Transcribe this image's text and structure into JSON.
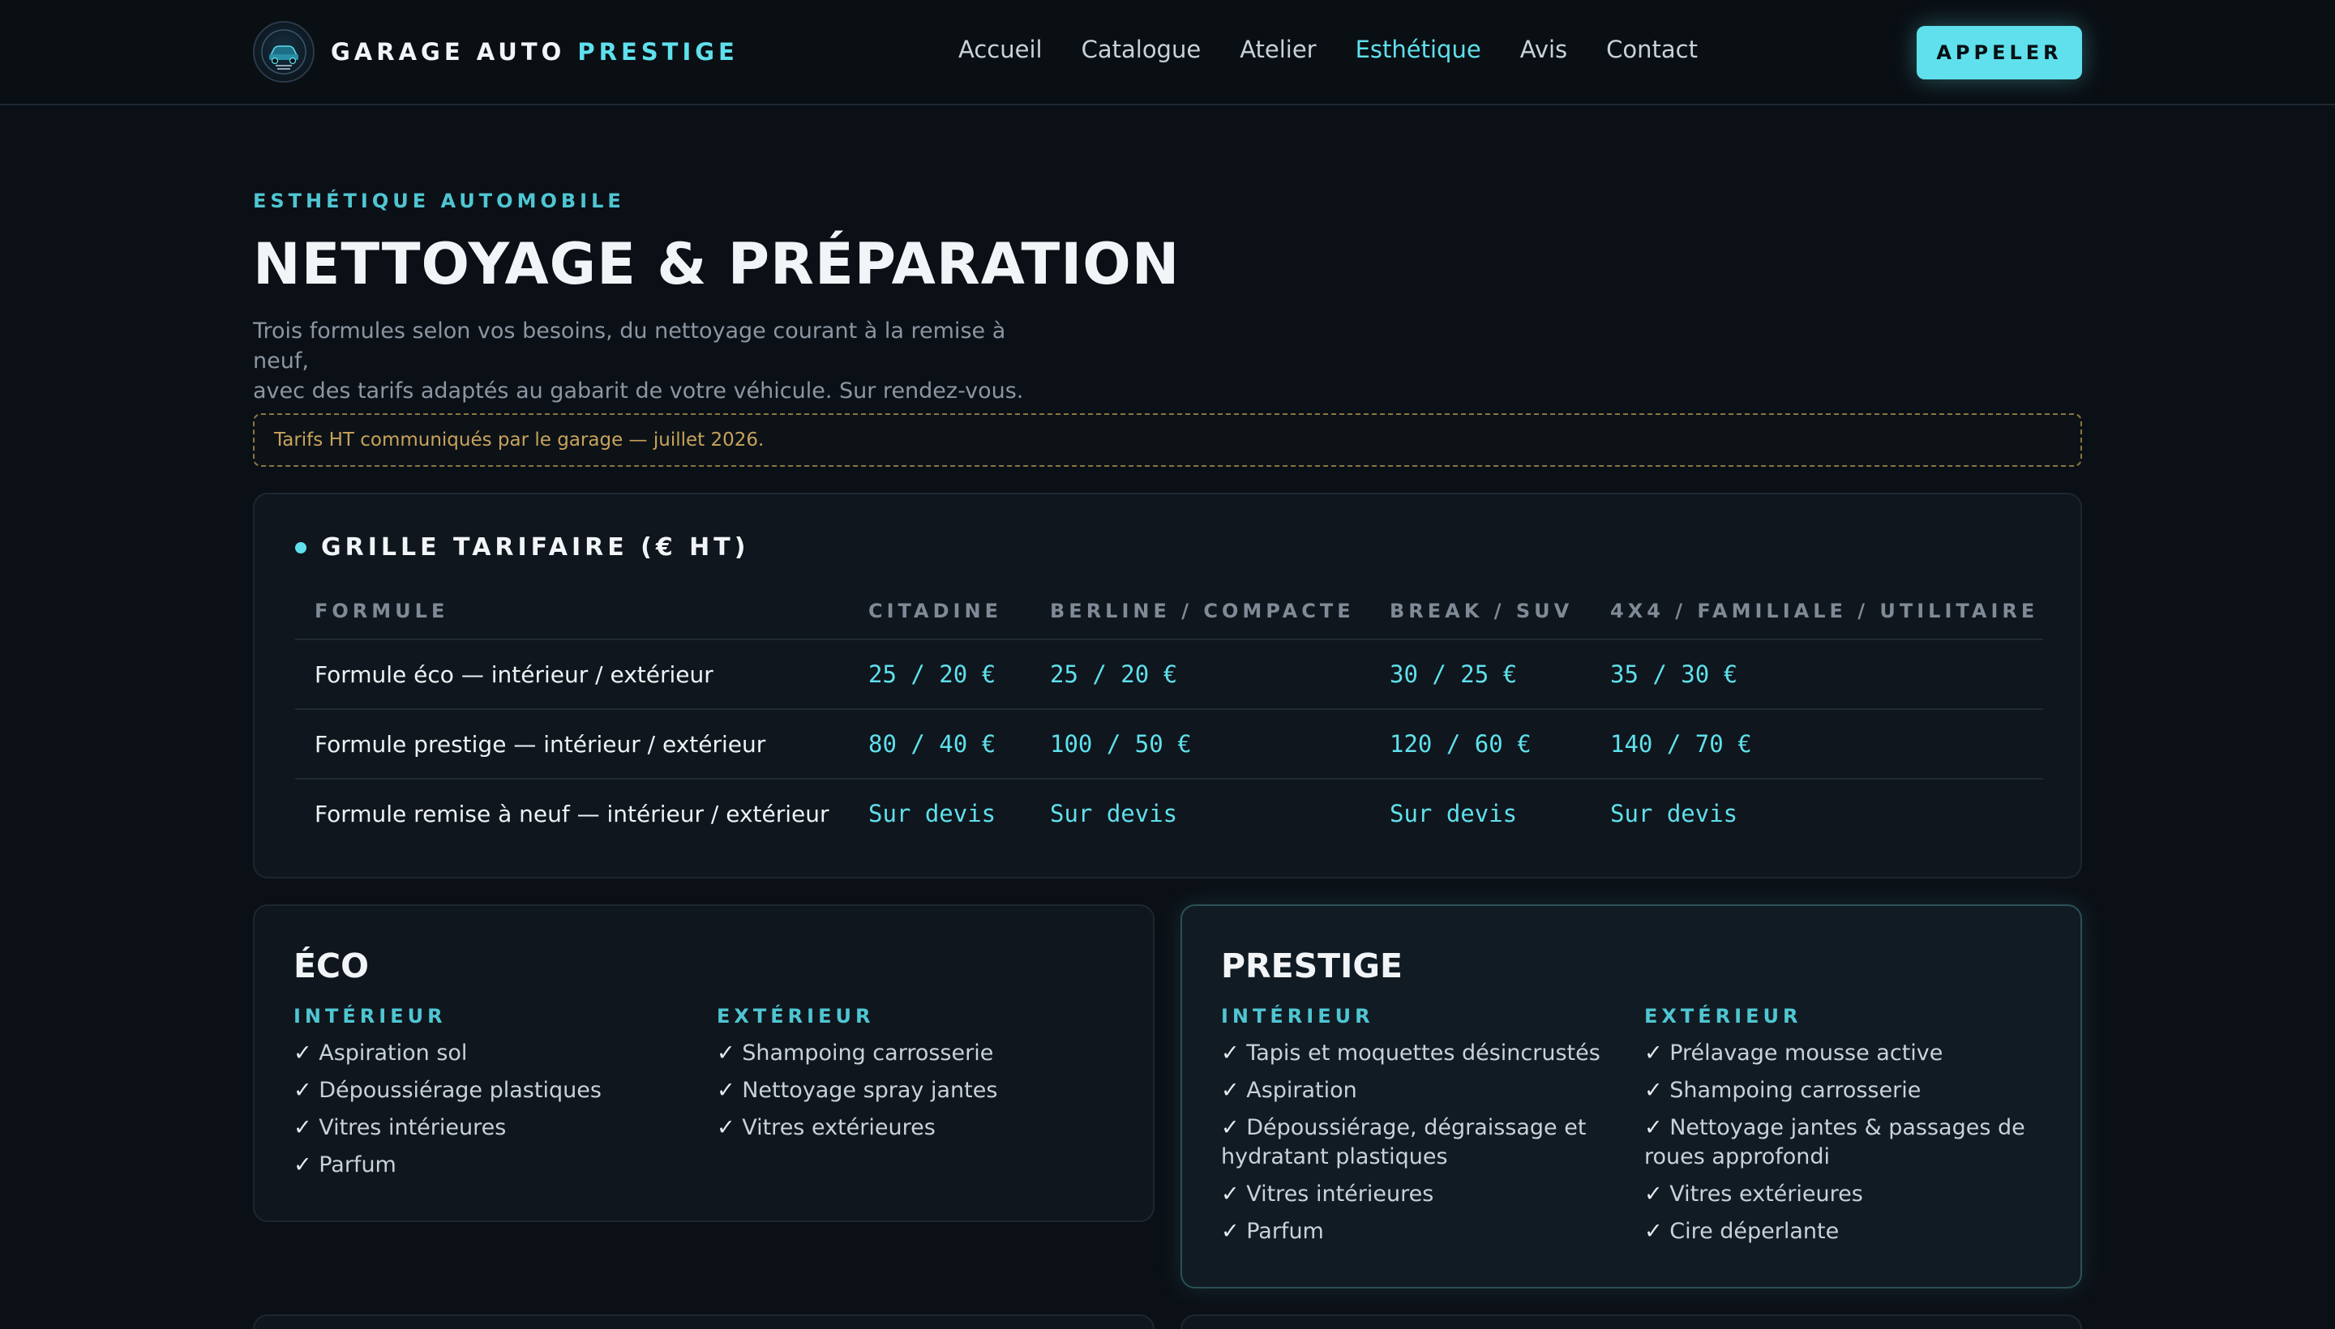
{
  "header": {
    "brand_main": "GARAGE AUTO",
    "brand_accent": "PRESTIGE",
    "logo_icon": "car-emblem-icon",
    "nav": [
      {
        "label": "Accueil",
        "active": false
      },
      {
        "label": "Catalogue",
        "active": false
      },
      {
        "label": "Atelier",
        "active": false
      },
      {
        "label": "Esthétique",
        "active": true
      },
      {
        "label": "Avis",
        "active": false
      },
      {
        "label": "Contact",
        "active": false
      }
    ],
    "call_label": "APPELER"
  },
  "hero": {
    "eyebrow": "ESTHÉTIQUE AUTOMOBILE",
    "title": "NETTOYAGE & PRÉPARATION",
    "intro_line1": "Trois formules selon vos besoins, du nettoyage courant à la remise à neuf,",
    "intro_line2": "avec des tarifs adaptés au gabarit de votre véhicule. Sur rendez-vous."
  },
  "note": "Tarifs HT communiqués par le garage — juillet 2026.",
  "grid": {
    "heading": "GRILLE TARIFAIRE (€ HT)",
    "columns": [
      "FORMULE",
      "CITADINE",
      "BERLINE / COMPACTE",
      "BREAK / SUV",
      "4X4 / FAMILIALE / UTILITAIRE"
    ],
    "rows": [
      {
        "formule": "Formule éco — intérieur / extérieur",
        "prices": [
          "25 / 20 €",
          "25 / 20 €",
          "30 / 25 €",
          "35 / 30 €"
        ]
      },
      {
        "formule": "Formule prestige — intérieur / extérieur",
        "prices": [
          "80 / 40 €",
          "100 / 50 €",
          "120 / 60 €",
          "140 / 70 €"
        ]
      },
      {
        "formule": "Formule remise à neuf — intérieur / extérieur",
        "prices": [
          "Sur devis",
          "Sur devis",
          "Sur devis",
          "Sur devis"
        ]
      }
    ]
  },
  "formulas": [
    {
      "title": "ÉCO",
      "interior_label": "INTÉRIEUR",
      "exterior_label": "EXTÉRIEUR",
      "interior": [
        "Aspiration sol",
        "Dépoussiérage plastiques",
        "Vitres intérieures",
        "Parfum"
      ],
      "exterior": [
        "Shampoing carrosserie",
        "Nettoyage spray jantes",
        "Vitres extérieures"
      ]
    },
    {
      "title": "PRESTIGE",
      "interior_label": "INTÉRIEUR",
      "exterior_label": "EXTÉRIEUR",
      "interior": [
        "Tapis et moquettes désincrustés",
        "Aspiration",
        "Dépoussiérage, dégraissage et hydratant plastiques",
        "Vitres intérieures",
        "Parfum"
      ],
      "exterior": [
        "Prélavage mousse active",
        "Shampoing carrosserie",
        "Nettoyage jantes & passages de roues approfondi",
        "Vitres extérieures",
        "Cire déperlante"
      ]
    }
  ],
  "check_glyph": "✓",
  "colors": {
    "background": "#0b1016",
    "accent": "#5fe0ec",
    "note": "#c8a35c"
  }
}
